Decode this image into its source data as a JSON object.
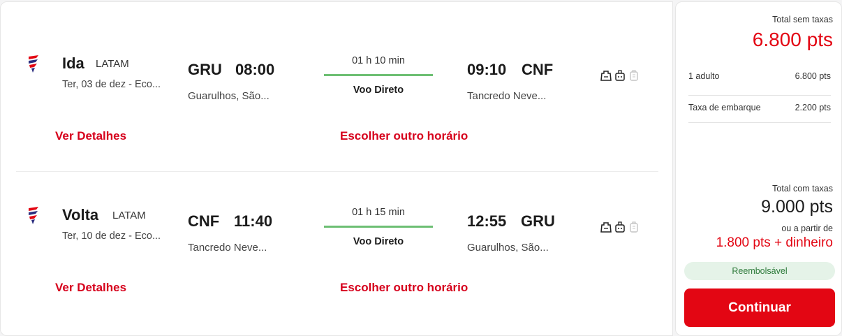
{
  "legs": [
    {
      "title": "Ida",
      "airline": "LATAM",
      "date": "Ter, 03 de dez - Eco...",
      "departure": {
        "code": "GRU",
        "time": "08:00",
        "city": "Guarulhos, São..."
      },
      "duration": "01 h 10 min",
      "flight_type": "Voo Direto",
      "arrival": {
        "time": "09:10",
        "code": "CNF",
        "city": "Tancredo Neve..."
      },
      "details_label": "Ver Detalhes",
      "change_label": "Escolher outro horário"
    },
    {
      "title": "Volta",
      "airline": "LATAM",
      "date": "Ter, 10 de dez - Eco...",
      "departure": {
        "code": "CNF",
        "time": "11:40",
        "city": "Tancredo Neve..."
      },
      "duration": "01 h 15 min",
      "flight_type": "Voo Direto",
      "arrival": {
        "time": "12:55",
        "code": "GRU",
        "city": "Guarulhos, São..."
      },
      "details_label": "Ver Detalhes",
      "change_label": "Escolher outro horário"
    }
  ],
  "icons": {
    "airline_logo": "latam-logo-icon",
    "baggage": [
      "personal-item-icon",
      "carry-on-bag-icon",
      "checked-bag-unavailable-icon"
    ]
  },
  "summary": {
    "total_sem_taxas_label": "Total sem taxas",
    "total_sem_taxas_value": "6.800 pts",
    "rows": [
      {
        "label": "1 adulto",
        "value": "6.800 pts"
      },
      {
        "label": "Taxa de embarque",
        "value": "2.200 pts"
      }
    ],
    "total_com_taxas_label": "Total com taxas",
    "total_com_taxas_value": "9.000 pts",
    "ou_a_partir_de": "ou a partir de",
    "pts_money": "1.800 pts + dinheiro",
    "refund_badge": "Reembolsável",
    "continue_label": "Continuar"
  },
  "colors": {
    "accent_red": "#e30613",
    "link_red": "#d6001c",
    "duration_line": "#6dbf73",
    "badge_green_bg": "#e5f3e8",
    "badge_green_text": "#2d7a3a"
  }
}
